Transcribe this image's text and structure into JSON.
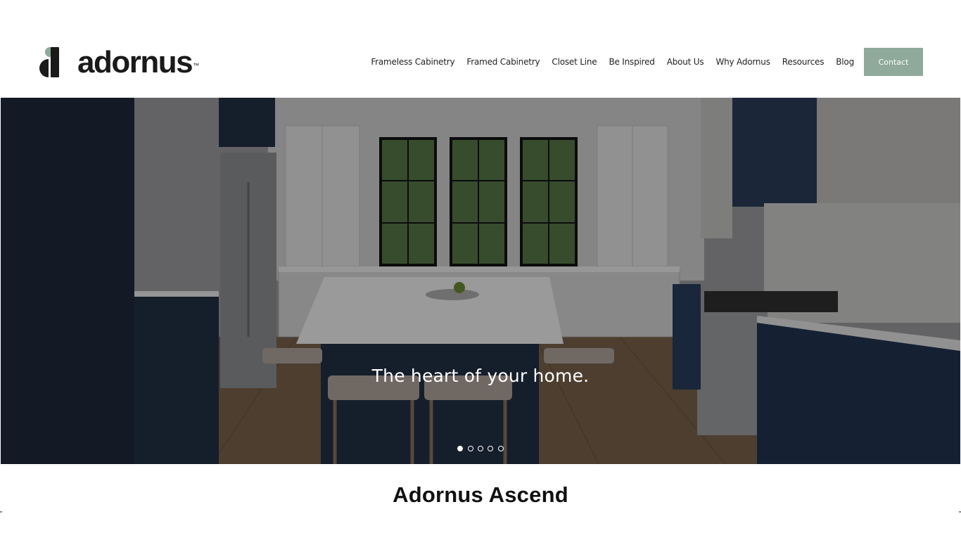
{
  "brand": {
    "name": "adornus",
    "trademark": "™",
    "accent_color": "#8fa99a"
  },
  "nav": {
    "items": [
      {
        "label": "Frameless Cabinetry"
      },
      {
        "label": "Framed Cabinetry"
      },
      {
        "label": "Closet Line"
      },
      {
        "label": "Be Inspired"
      },
      {
        "label": "About Us"
      },
      {
        "label": "Why Adornus"
      },
      {
        "label": "Resources"
      },
      {
        "label": "Blog"
      }
    ],
    "contact_label": "Contact"
  },
  "hero": {
    "tagline": "The heart of your home.",
    "slide_count": 5,
    "active_slide": 1
  },
  "section": {
    "title": "Adornus Ascend"
  }
}
